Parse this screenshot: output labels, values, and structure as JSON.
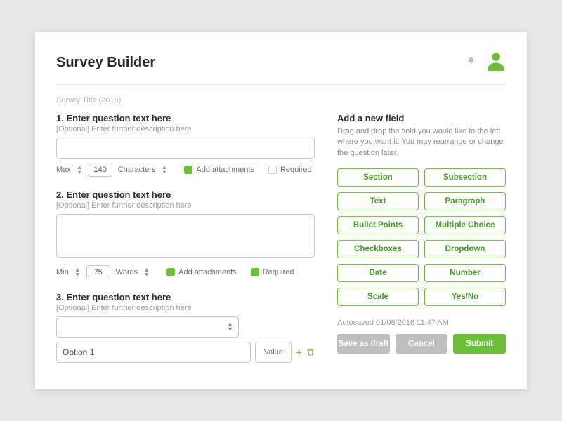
{
  "header": {
    "title": "Survey Builder"
  },
  "subtitle": "Survey Title (2016)",
  "questions": [
    {
      "title": "1. Enter question text here",
      "desc": "[Optional] Enter further description here",
      "limitLabel": "Max",
      "limitValue": "140",
      "unitLabel": "Characters",
      "attachLabel": "Add attachments",
      "attachOn": true,
      "requiredLabel": "Required",
      "requiredOn": false
    },
    {
      "title": "2. Enter question text here",
      "desc": "[Optional] Enter further description here",
      "limitLabel": "Min",
      "limitValue": "75",
      "unitLabel": "Words",
      "attachLabel": "Add attachments",
      "attachOn": true,
      "requiredLabel": "Required",
      "requiredOn": true
    },
    {
      "title": "3. Enter question text here",
      "desc": "[Optional] Enter further description here",
      "option1": "Option 1",
      "valuePlaceholder": "Value"
    }
  ],
  "right": {
    "title": "Add a new field",
    "desc": "Drag and drop the field you would like to the left where you want it. You may rearrange or change the question later.",
    "fields": [
      "Section",
      "Subsection",
      "Text",
      "Paragraph",
      "Bullet Points",
      "Multiple Choice",
      "Checkboxes",
      "Dropdown",
      "Date",
      "Number",
      "Scale",
      "Yes/No"
    ],
    "autosave": "Autosaved 01/08/2016 11:47 AM",
    "saveDraft": "Save as draft",
    "cancel": "Cancel",
    "submit": "Submit"
  }
}
